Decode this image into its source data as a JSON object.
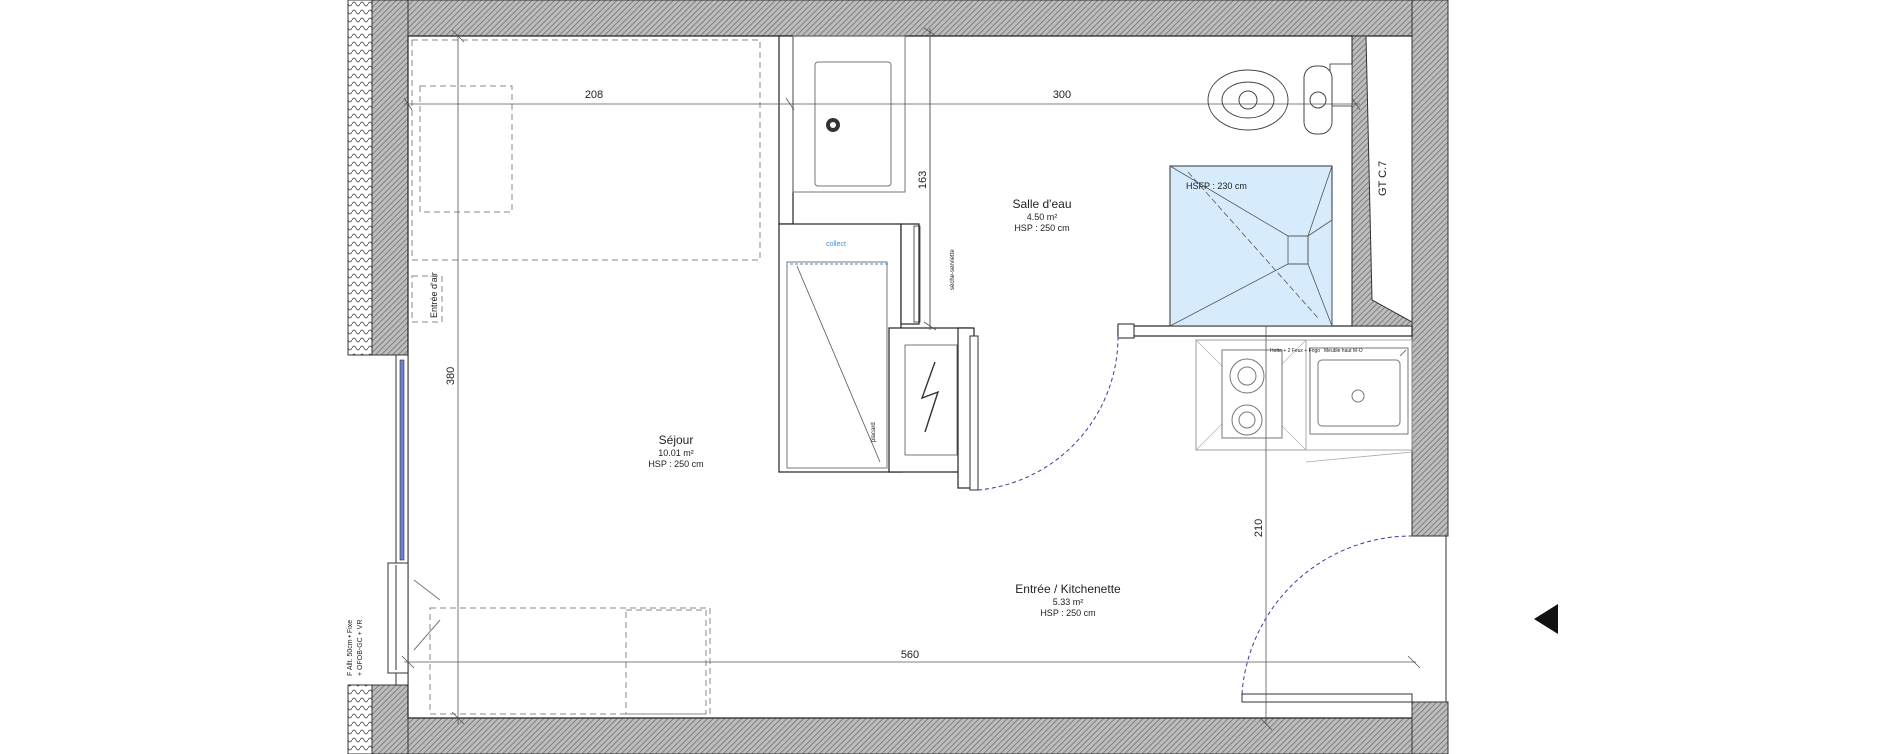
{
  "rooms": {
    "sejour": {
      "name": "Séjour",
      "area": "10.01 m²",
      "hsp": "HSP : 250 cm"
    },
    "salle_eau": {
      "name": "Salle d'eau",
      "area": "4.50 m²",
      "hsp": "HSP : 250 cm"
    },
    "entree": {
      "name": "Entrée / Kitchenette",
      "area": "5.33 m²",
      "hsp": "HSP : 250 cm"
    }
  },
  "labels": {
    "shower_hsfp": "HSFP : 230 cm",
    "gt": "GT C.7",
    "entree_air": "Entrée d'air",
    "collect": "collect",
    "placard": "placard",
    "seche_serviette": "sèche-serviette",
    "window_line1": "F Allt. 50cm • Fixe",
    "window_line2": "+ OFOB-GC + VR",
    "hotte": "Hotte + 2 Feux + Frigo",
    "meuble": "Meuble haut M-O"
  },
  "dimensions": {
    "d208": "208",
    "d300": "300",
    "d163": "163",
    "d380": "380",
    "d210": "210",
    "d560": "560"
  },
  "colors": {
    "wall_hatch": "#9a9a9a",
    "shower_fill": "#d6ebfb",
    "door_arc": "#3a3aa0",
    "collect_text": "#3a8fd6"
  },
  "icons": {
    "north_arrow": "left-pointing-triangle"
  }
}
